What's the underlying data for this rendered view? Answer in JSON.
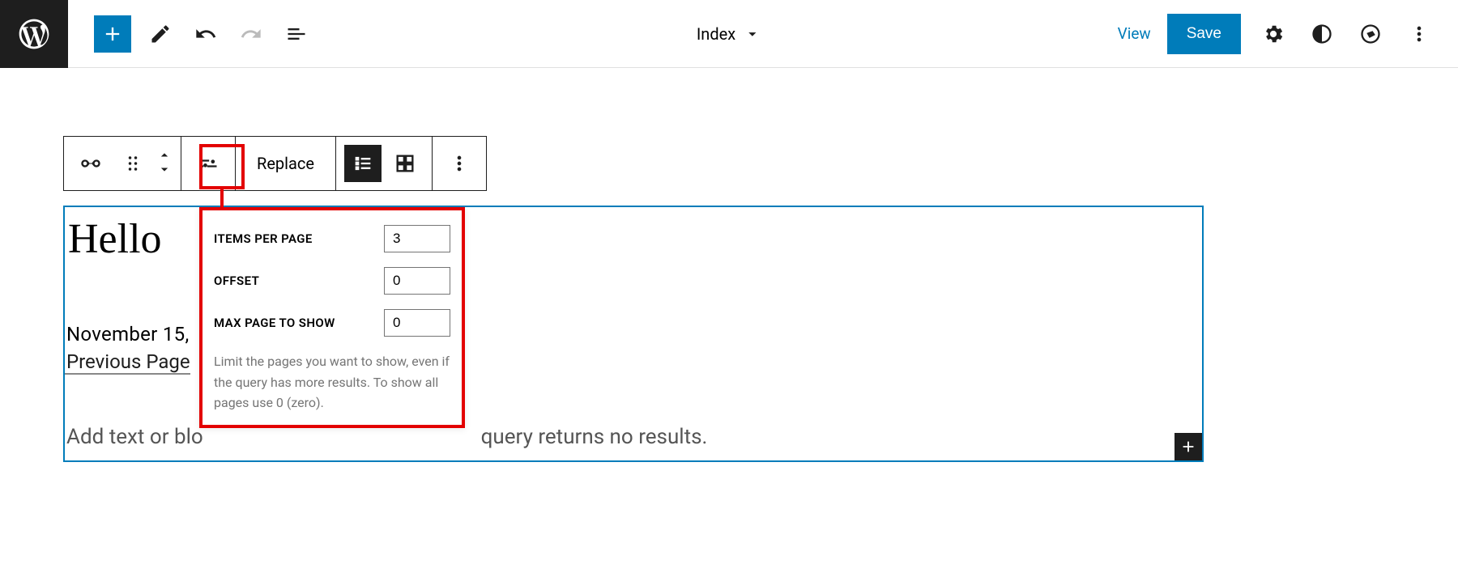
{
  "header": {
    "template_name": "Index",
    "view_label": "View",
    "save_label": "Save"
  },
  "block_toolbar": {
    "replace_label": "Replace"
  },
  "popover": {
    "items_per_page": {
      "label": "Items per page",
      "value": "3"
    },
    "offset": {
      "label": "Offset",
      "value": "0"
    },
    "max_page": {
      "label": "Max page to show",
      "value": "0"
    },
    "help_text": "Limit the pages you want to show, even if the query has more results. To show all pages use 0 (zero)."
  },
  "content": {
    "post_title": "Hello",
    "post_date": "November 15,",
    "prev_page_label": "Previous Page",
    "no_results_placeholder": "Add text or blo",
    "no_results_tail": "query returns no results."
  }
}
